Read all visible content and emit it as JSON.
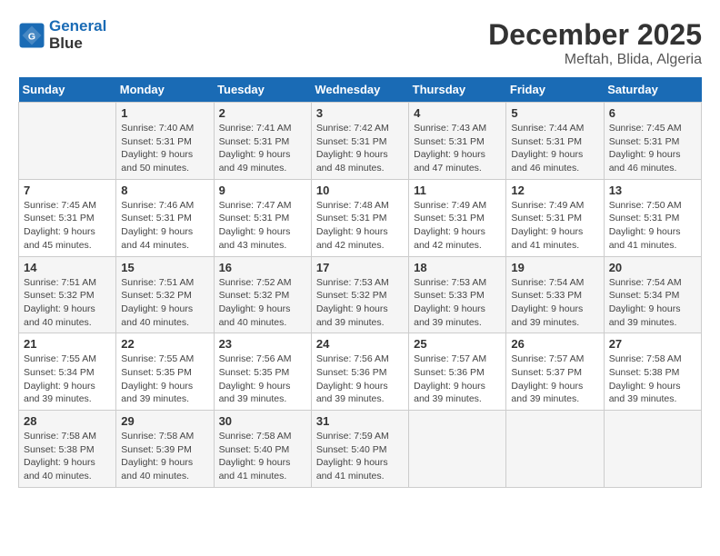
{
  "header": {
    "logo_line1": "General",
    "logo_line2": "Blue",
    "month": "December 2025",
    "location": "Meftah, Blida, Algeria"
  },
  "weekdays": [
    "Sunday",
    "Monday",
    "Tuesday",
    "Wednesday",
    "Thursday",
    "Friday",
    "Saturday"
  ],
  "weeks": [
    [
      {
        "day": "",
        "content": ""
      },
      {
        "day": "1",
        "content": "Sunrise: 7:40 AM\nSunset: 5:31 PM\nDaylight: 9 hours\nand 50 minutes."
      },
      {
        "day": "2",
        "content": "Sunrise: 7:41 AM\nSunset: 5:31 PM\nDaylight: 9 hours\nand 49 minutes."
      },
      {
        "day": "3",
        "content": "Sunrise: 7:42 AM\nSunset: 5:31 PM\nDaylight: 9 hours\nand 48 minutes."
      },
      {
        "day": "4",
        "content": "Sunrise: 7:43 AM\nSunset: 5:31 PM\nDaylight: 9 hours\nand 47 minutes."
      },
      {
        "day": "5",
        "content": "Sunrise: 7:44 AM\nSunset: 5:31 PM\nDaylight: 9 hours\nand 46 minutes."
      },
      {
        "day": "6",
        "content": "Sunrise: 7:45 AM\nSunset: 5:31 PM\nDaylight: 9 hours\nand 46 minutes."
      }
    ],
    [
      {
        "day": "7",
        "content": "Sunrise: 7:45 AM\nSunset: 5:31 PM\nDaylight: 9 hours\nand 45 minutes."
      },
      {
        "day": "8",
        "content": "Sunrise: 7:46 AM\nSunset: 5:31 PM\nDaylight: 9 hours\nand 44 minutes."
      },
      {
        "day": "9",
        "content": "Sunrise: 7:47 AM\nSunset: 5:31 PM\nDaylight: 9 hours\nand 43 minutes."
      },
      {
        "day": "10",
        "content": "Sunrise: 7:48 AM\nSunset: 5:31 PM\nDaylight: 9 hours\nand 42 minutes."
      },
      {
        "day": "11",
        "content": "Sunrise: 7:49 AM\nSunset: 5:31 PM\nDaylight: 9 hours\nand 42 minutes."
      },
      {
        "day": "12",
        "content": "Sunrise: 7:49 AM\nSunset: 5:31 PM\nDaylight: 9 hours\nand 41 minutes."
      },
      {
        "day": "13",
        "content": "Sunrise: 7:50 AM\nSunset: 5:31 PM\nDaylight: 9 hours\nand 41 minutes."
      }
    ],
    [
      {
        "day": "14",
        "content": "Sunrise: 7:51 AM\nSunset: 5:32 PM\nDaylight: 9 hours\nand 40 minutes."
      },
      {
        "day": "15",
        "content": "Sunrise: 7:51 AM\nSunset: 5:32 PM\nDaylight: 9 hours\nand 40 minutes."
      },
      {
        "day": "16",
        "content": "Sunrise: 7:52 AM\nSunset: 5:32 PM\nDaylight: 9 hours\nand 40 minutes."
      },
      {
        "day": "17",
        "content": "Sunrise: 7:53 AM\nSunset: 5:32 PM\nDaylight: 9 hours\nand 39 minutes."
      },
      {
        "day": "18",
        "content": "Sunrise: 7:53 AM\nSunset: 5:33 PM\nDaylight: 9 hours\nand 39 minutes."
      },
      {
        "day": "19",
        "content": "Sunrise: 7:54 AM\nSunset: 5:33 PM\nDaylight: 9 hours\nand 39 minutes."
      },
      {
        "day": "20",
        "content": "Sunrise: 7:54 AM\nSunset: 5:34 PM\nDaylight: 9 hours\nand 39 minutes."
      }
    ],
    [
      {
        "day": "21",
        "content": "Sunrise: 7:55 AM\nSunset: 5:34 PM\nDaylight: 9 hours\nand 39 minutes."
      },
      {
        "day": "22",
        "content": "Sunrise: 7:55 AM\nSunset: 5:35 PM\nDaylight: 9 hours\nand 39 minutes."
      },
      {
        "day": "23",
        "content": "Sunrise: 7:56 AM\nSunset: 5:35 PM\nDaylight: 9 hours\nand 39 minutes."
      },
      {
        "day": "24",
        "content": "Sunrise: 7:56 AM\nSunset: 5:36 PM\nDaylight: 9 hours\nand 39 minutes."
      },
      {
        "day": "25",
        "content": "Sunrise: 7:57 AM\nSunset: 5:36 PM\nDaylight: 9 hours\nand 39 minutes."
      },
      {
        "day": "26",
        "content": "Sunrise: 7:57 AM\nSunset: 5:37 PM\nDaylight: 9 hours\nand 39 minutes."
      },
      {
        "day": "27",
        "content": "Sunrise: 7:58 AM\nSunset: 5:38 PM\nDaylight: 9 hours\nand 39 minutes."
      }
    ],
    [
      {
        "day": "28",
        "content": "Sunrise: 7:58 AM\nSunset: 5:38 PM\nDaylight: 9 hours\nand 40 minutes."
      },
      {
        "day": "29",
        "content": "Sunrise: 7:58 AM\nSunset: 5:39 PM\nDaylight: 9 hours\nand 40 minutes."
      },
      {
        "day": "30",
        "content": "Sunrise: 7:58 AM\nSunset: 5:40 PM\nDaylight: 9 hours\nand 41 minutes."
      },
      {
        "day": "31",
        "content": "Sunrise: 7:59 AM\nSunset: 5:40 PM\nDaylight: 9 hours\nand 41 minutes."
      },
      {
        "day": "",
        "content": ""
      },
      {
        "day": "",
        "content": ""
      },
      {
        "day": "",
        "content": ""
      }
    ]
  ]
}
